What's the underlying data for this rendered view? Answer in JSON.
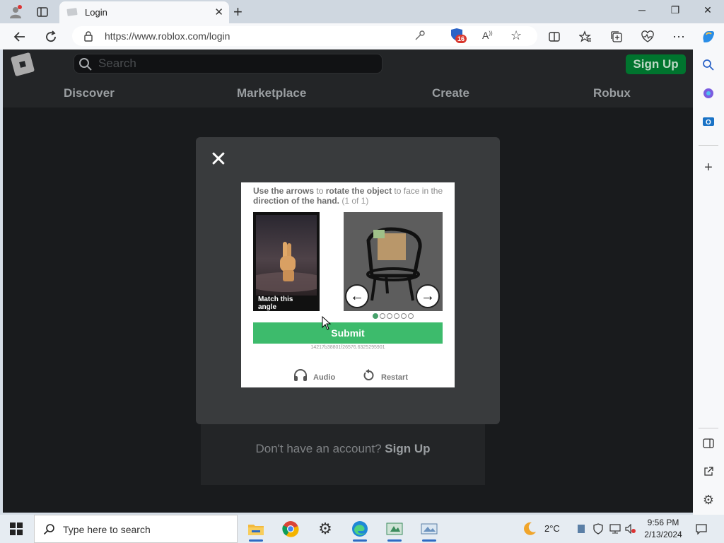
{
  "browser": {
    "tab_title": "Login",
    "url": "https://www.roblox.com/login",
    "extension_badge": "16"
  },
  "roblox": {
    "search_placeholder": "Search",
    "signup_label": "Sign Up",
    "nav": [
      "Discover",
      "Marketplace",
      "Create",
      "Robux"
    ],
    "no_account_text": "Don't have an account?",
    "no_account_link": "Sign Up"
  },
  "captcha": {
    "instr_1": "Use the arrows",
    "instr_2": " to ",
    "instr_3": "rotate the object",
    "instr_4": " to face in the ",
    "instr_5": "direction of the hand.",
    "instr_6": " (1 of 1)",
    "reference_caption": "Match this angle",
    "left_arrow": "←",
    "right_arrow": "→",
    "submit_label": "Submit",
    "session_id": "14217b38801f26576.6325295901",
    "audio_label": "Audio",
    "restart_label": "Restart",
    "progress_dots": 6,
    "progress_active": 0
  },
  "taskbar": {
    "search_placeholder": "Type here to search",
    "weather": "2°C",
    "time": "9:56 PM",
    "date": "2/13/2024"
  },
  "colors": {
    "submit_green": "#3dbb6c",
    "signup_green": "#00742e",
    "page_bg": "#191b1d"
  }
}
